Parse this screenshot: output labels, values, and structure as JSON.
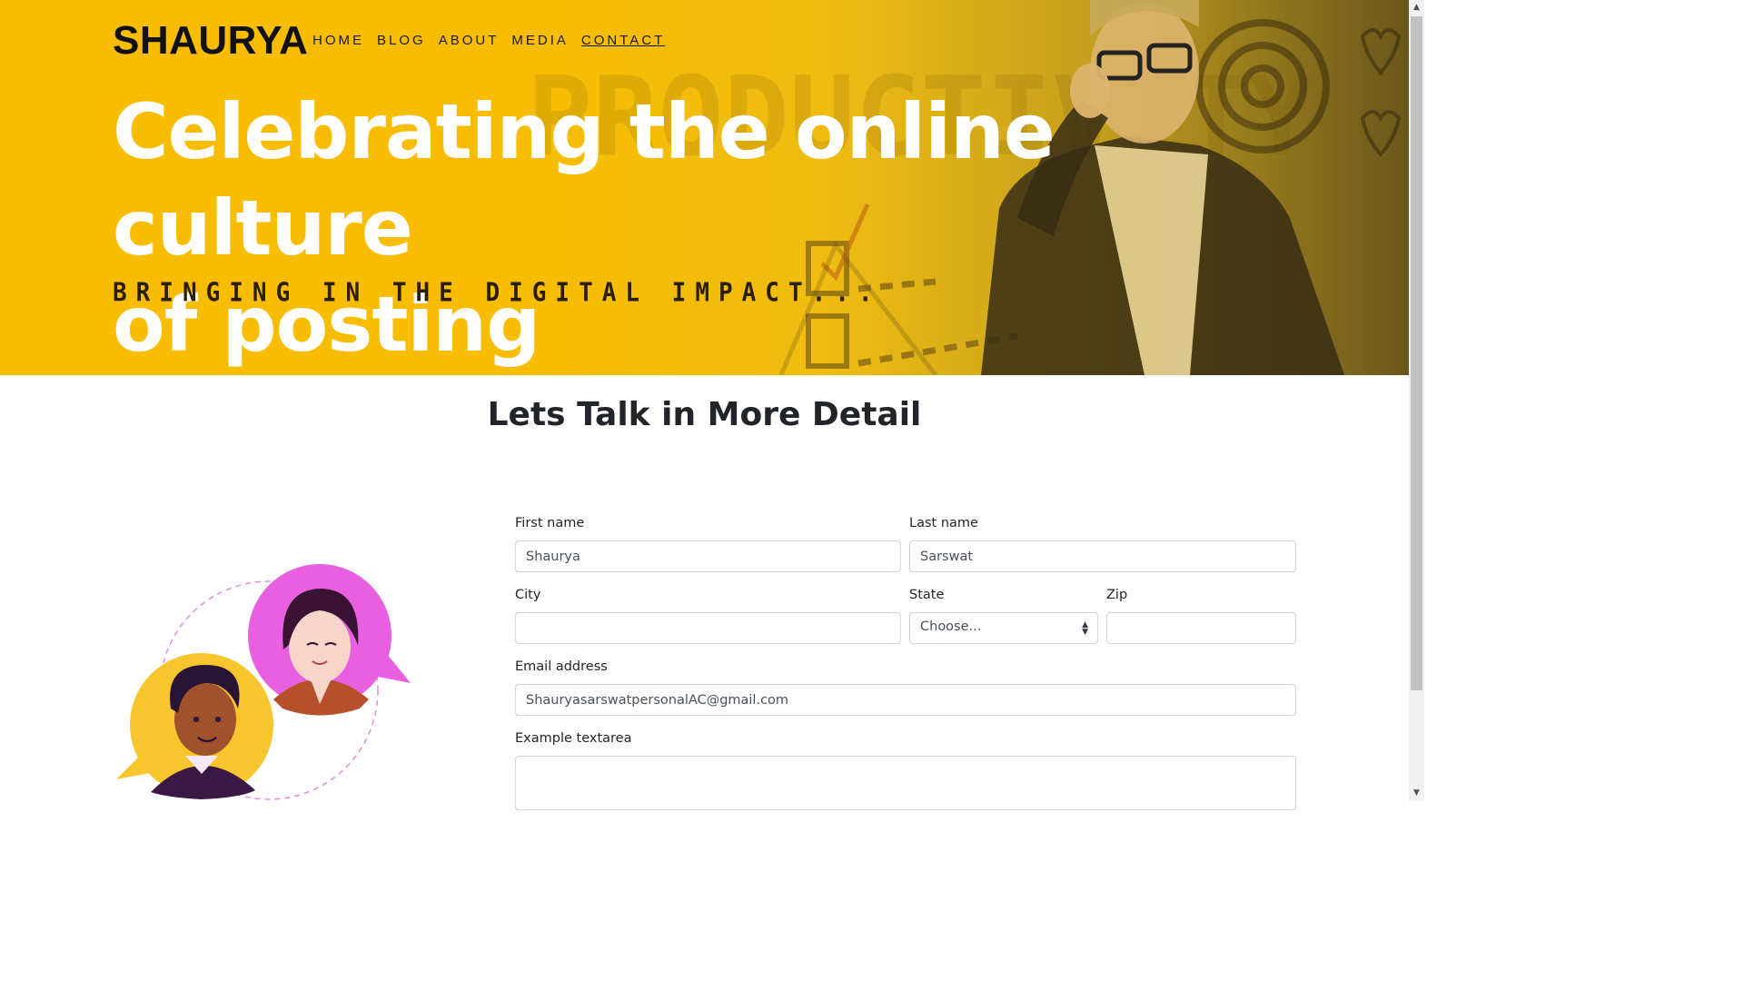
{
  "brand": "SHAURYA",
  "nav": [
    {
      "label": "HOME"
    },
    {
      "label": "BLOG"
    },
    {
      "label": "ABOUT"
    },
    {
      "label": "MEDIA"
    },
    {
      "label": "CONTACT",
      "active": true
    }
  ],
  "hero": {
    "headline_line1": "Celebrating the online culture",
    "headline_line2": "of posting",
    "tagline": "BRINGING IN THE DIGITAL IMPACT...",
    "background_text": "PRODUCTIVITY"
  },
  "section": {
    "title": "Lets Talk in More Detail"
  },
  "form": {
    "first_name": {
      "label": "First name",
      "value": "Shaurya"
    },
    "last_name": {
      "label": "Last name",
      "value": "Sarswat"
    },
    "city": {
      "label": "City",
      "value": ""
    },
    "state": {
      "label": "State",
      "selected": "Choose..."
    },
    "zip": {
      "label": "Zip",
      "value": ""
    },
    "email": {
      "label": "Email address",
      "value": "ShauryasarswatpersonalAC@gmail.com"
    },
    "textarea": {
      "label": "Example textarea",
      "value": ""
    }
  },
  "colors": {
    "hero_yellow": "#f8bd00",
    "illustration_pink": "#e85fe0",
    "illustration_yellow": "#f7c62f"
  },
  "icons": {
    "scroll_up": "triangle-up",
    "scroll_down": "triangle-down",
    "select_caret": "up-down-caret"
  }
}
